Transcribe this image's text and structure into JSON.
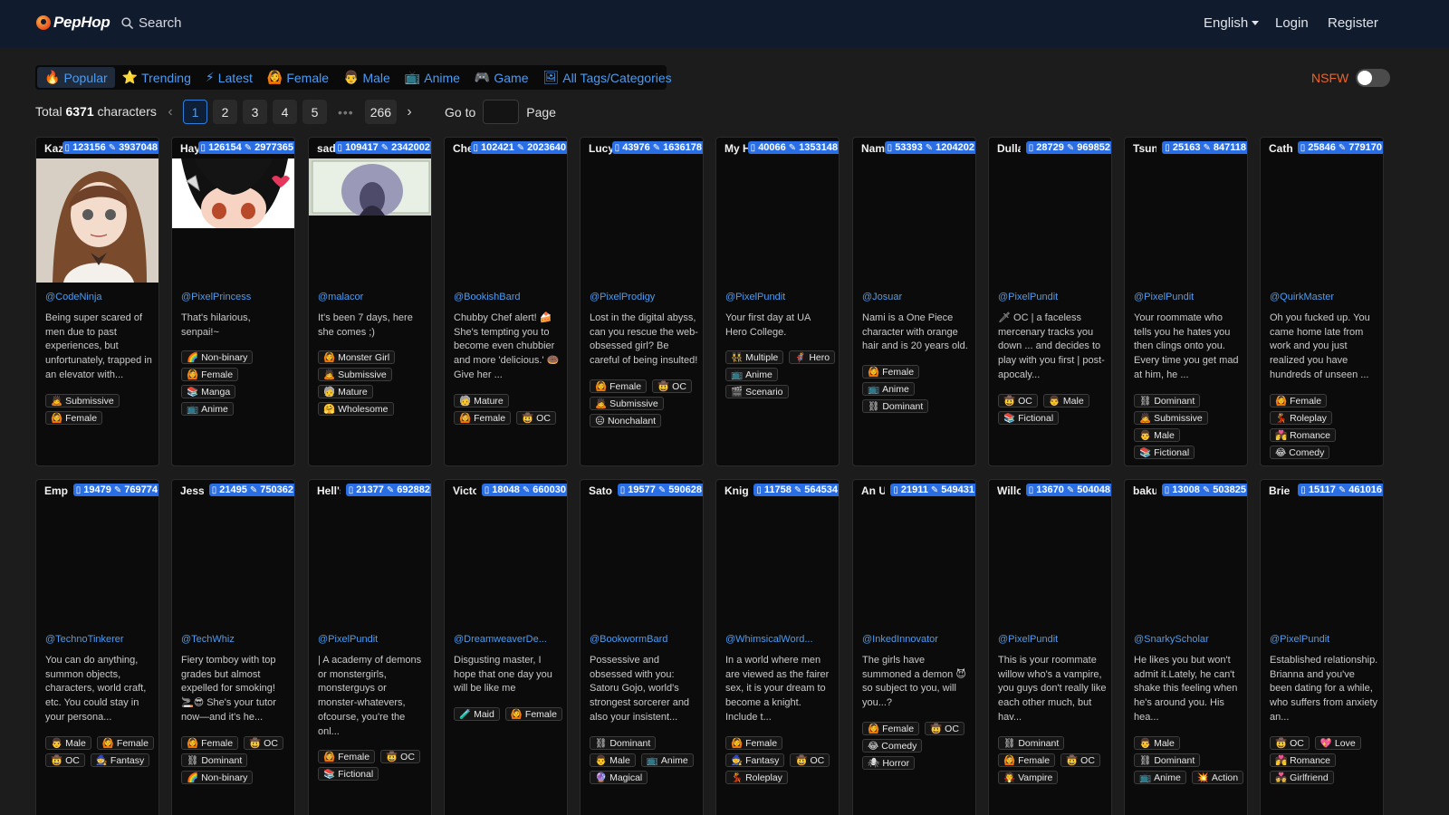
{
  "header": {
    "logo": "PepHop",
    "search_label": "Search",
    "language": "English",
    "login": "Login",
    "register": "Register"
  },
  "tabs": [
    {
      "icon": "🔥",
      "label": "Popular",
      "active": true
    },
    {
      "icon": "⭐",
      "label": "Trending"
    },
    {
      "icon": "⚡",
      "label": "Latest"
    },
    {
      "icon": "🙆",
      "label": "Female"
    },
    {
      "icon": "👨",
      "label": "Male"
    },
    {
      "icon": "📺",
      "label": "Anime"
    },
    {
      "icon": "🎮",
      "label": "Game"
    },
    {
      "icon": "🖼",
      "label": "All Tags/Categories"
    }
  ],
  "nsfw": {
    "label": "NSFW",
    "enabled": false
  },
  "pagination": {
    "total_prefix": "Total",
    "total": "6371",
    "total_suffix": "characters",
    "prev": "‹",
    "next": "›",
    "pages": [
      "1",
      "2",
      "3",
      "4",
      "5"
    ],
    "current": "1",
    "ellipsis": "•••",
    "last": "266",
    "goto_label": "Go to",
    "goto_value": "",
    "page_label": "Page"
  },
  "cards": [
    {
      "name": "Kazu",
      "chats": "123156",
      "messages": "3937048",
      "author": "@CodeNinja",
      "desc": "Being super scared of men due to past experiences, but unfortunately, trapped in an elevator with...",
      "tags": [
        [
          "🙇",
          "Submissive"
        ],
        [
          "🙆",
          "Female"
        ]
      ],
      "thumb": "portrait"
    },
    {
      "name": "Haya",
      "chats": "126154",
      "messages": "2977365",
      "author": "@PixelPrincess",
      "desc": "That's hilarious, senpai!~",
      "tags": [
        [
          "🌈",
          "Non-binary"
        ],
        [
          "🙆",
          "Female"
        ],
        [
          "📚",
          "Manga"
        ],
        [
          "📺",
          "Anime"
        ]
      ],
      "thumb": "anime"
    },
    {
      "name": "sada",
      "chats": "109417",
      "messages": "2342002",
      "author": "@malacor",
      "desc": "It's been 7 days, here she comes ;)",
      "tags": [
        [
          "🙆",
          "Monster Girl"
        ],
        [
          "🙇",
          "Submissive"
        ],
        [
          "🧓",
          "Mature"
        ],
        [
          "🤗",
          "Wholesome"
        ]
      ],
      "thumb": "ghost"
    },
    {
      "name": "Chef",
      "chats": "102421",
      "messages": "2023640",
      "author": "@BookishBard",
      "desc": "Chubby Chef alert! 🍰 She's tempting you to become even chubbier and more 'delicious.' 🍩 Give her ...",
      "tags": [
        [
          "🧓",
          "Mature"
        ],
        [
          "🙆",
          "Female"
        ],
        [
          "🤠",
          "OC"
        ]
      ],
      "thumb": ""
    },
    {
      "name": "Lucy",
      "chats": "43976",
      "messages": "1636178",
      "author": "@PixelProdigy",
      "desc": "Lost in the digital abyss, can you rescue the web-obsessed girl? Be careful of being insulted!",
      "tags": [
        [
          "🙆",
          "Female"
        ],
        [
          "🤠",
          "OC"
        ],
        [
          "🙇",
          "Submissive"
        ],
        [
          "😑",
          "Nonchalant"
        ]
      ],
      "thumb": ""
    },
    {
      "name": "My H",
      "chats": "40066",
      "messages": "1353148",
      "author": "@PixelPundit",
      "desc": "Your first day at UA Hero College.",
      "tags": [
        [
          "👯",
          "Multiple"
        ],
        [
          "🦸",
          "Hero"
        ],
        [
          "📺",
          "Anime"
        ],
        [
          "🎬",
          "Scenario"
        ]
      ],
      "thumb": ""
    },
    {
      "name": "Nami",
      "chats": "53393",
      "messages": "1204202",
      "author": "@Josuar",
      "desc": "Nami is a One Piece character with orange hair and is 20 years old.",
      "tags": [
        [
          "🙆",
          "Female"
        ],
        [
          "📺",
          "Anime"
        ],
        [
          "⛓",
          "Dominant"
        ]
      ],
      "thumb": ""
    },
    {
      "name": "Dullah",
      "chats": "28729",
      "messages": "969852",
      "author": "@PixelPundit",
      "desc": "🗡 OC | a faceless mercenary tracks you down ... and decides to play with you first | post-apocaly...",
      "tags": [
        [
          "🤠",
          "OC"
        ],
        [
          "👨",
          "Male"
        ],
        [
          "📚",
          "Fictional"
        ]
      ],
      "thumb": ""
    },
    {
      "name": "Tsunde",
      "chats": "25163",
      "messages": "847118",
      "author": "@PixelPundit",
      "desc": "Your roommate who tells you he hates you then clings onto you. Every time you get mad at him, he ...",
      "tags": [
        [
          "⛓",
          "Dominant"
        ],
        [
          "🙇",
          "Submissive"
        ],
        [
          "👨",
          "Male"
        ],
        [
          "📚",
          "Fictional"
        ]
      ],
      "thumb": ""
    },
    {
      "name": "Cathle",
      "chats": "25846",
      "messages": "779170",
      "author": "@QuirkMaster",
      "desc": "Oh you fucked up. You came home late from work and you just realized you have hundreds of unseen ...",
      "tags": [
        [
          "🙆",
          "Female"
        ],
        [
          "💃",
          "Roleplay"
        ],
        [
          "💏",
          "Romance"
        ],
        [
          "😂",
          "Comedy"
        ]
      ],
      "thumb": ""
    },
    {
      "name": "Empty",
      "chats": "19479",
      "messages": "769774",
      "author": "@TechnoTinkerer",
      "desc": "You can do anything, summon objects, characters, world craft, etc. You could stay in your persona...",
      "tags": [
        [
          "👨",
          "Male"
        ],
        [
          "🙆",
          "Female"
        ],
        [
          "🤠",
          "OC"
        ],
        [
          "🧙",
          "Fantasy"
        ]
      ],
      "thumb": ""
    },
    {
      "name": "Jessie",
      "chats": "21495",
      "messages": "750362",
      "author": "@TechWhiz",
      "desc": "Fiery tomboy with top grades but almost expelled for smoking! 🚬😎 She's your tutor now—and it's he...",
      "tags": [
        [
          "🙆",
          "Female"
        ],
        [
          "🤠",
          "OC"
        ],
        [
          "⛓",
          "Dominant"
        ],
        [
          "🌈",
          "Non-binary"
        ]
      ],
      "thumb": ""
    },
    {
      "name": "Hell's",
      "chats": "21377",
      "messages": "692882",
      "author": "@PixelPundit",
      "desc": "| A academy of demons or monstergirls, monsterguys or monster-whatevers, ofcourse, you're the onl...",
      "tags": [
        [
          "🙆",
          "Female"
        ],
        [
          "🤠",
          "OC"
        ],
        [
          "📚",
          "Fictional"
        ]
      ],
      "thumb": ""
    },
    {
      "name": "Victor",
      "chats": "18048",
      "messages": "660030",
      "author": "@DreamweaverDe...",
      "desc": "Disgusting master, I hope that one day you will be like me",
      "tags": [
        [
          "🧪",
          "Maid"
        ],
        [
          "🙆",
          "Female"
        ]
      ],
      "thumb": ""
    },
    {
      "name": "Satoru",
      "chats": "19577",
      "messages": "590628",
      "author": "@BookwormBard",
      "desc": "Possessive and obsessed with you: Satoru Gojo, world's strongest sorcerer and also your insistent...",
      "tags": [
        [
          "⛓",
          "Dominant"
        ],
        [
          "👨",
          "Male"
        ],
        [
          "📺",
          "Anime"
        ],
        [
          "🔮",
          "Magical"
        ]
      ],
      "thumb": ""
    },
    {
      "name": "Knight",
      "chats": "11758",
      "messages": "564534",
      "author": "@WhimsicalWord...",
      "desc": "In a world where men are viewed as the fairer sex, it is your dream to become a knight. Include t...",
      "tags": [
        [
          "🙆",
          "Female"
        ],
        [
          "🧙",
          "Fantasy"
        ],
        [
          "🤠",
          "OC"
        ],
        [
          "💃",
          "Roleplay"
        ]
      ],
      "thumb": ""
    },
    {
      "name": "An Unh",
      "chats": "21911",
      "messages": "549431",
      "author": "@InkedInnovator",
      "desc": "The girls have summoned a demon 😈 so subject to you, will you...?",
      "tags": [
        [
          "🙆",
          "Female"
        ],
        [
          "🤠",
          "OC"
        ],
        [
          "😂",
          "Comedy"
        ],
        [
          "🕷",
          "Horror"
        ]
      ],
      "thumb": ""
    },
    {
      "name": "Willow",
      "chats": "13670",
      "messages": "504048",
      "author": "@PixelPundit",
      "desc": "This is your roommate willow who's a vampire, you guys don't really like each other much, but hav...",
      "tags": [
        [
          "⛓",
          "Dominant"
        ],
        [
          "🙆",
          "Female"
        ],
        [
          "🤠",
          "OC"
        ],
        [
          "🧛",
          "Vampire"
        ]
      ],
      "thumb": ""
    },
    {
      "name": "bakug",
      "chats": "13008",
      "messages": "503825",
      "author": "@SnarkyScholar",
      "desc": "He likes you but won't admit it.Lately, he can't shake this feeling when he's around you. His hea...",
      "tags": [
        [
          "👨",
          "Male"
        ],
        [
          "⛓",
          "Dominant"
        ],
        [
          "📺",
          "Anime"
        ],
        [
          "💥",
          "Action"
        ]
      ],
      "thumb": ""
    },
    {
      "name": "Brie",
      "chats": "15117",
      "messages": "461016",
      "author": "@PixelPundit",
      "desc": "Established relationship. Brianna and you've been dating for a while, who suffers from anxiety an...",
      "tags": [
        [
          "🤠",
          "OC"
        ],
        [
          "💖",
          "Love"
        ],
        [
          "💏",
          "Romance"
        ],
        [
          "💑",
          "Girlfriend"
        ]
      ],
      "thumb": ""
    }
  ]
}
